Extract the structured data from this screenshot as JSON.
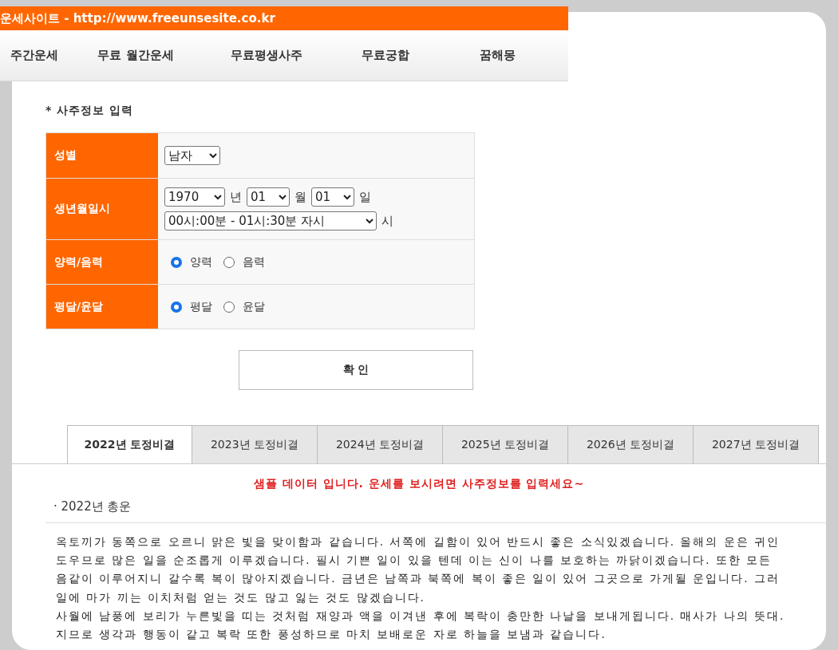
{
  "site_title": "운세사이트 - http://www.freeunsesite.co.kr",
  "nav": [
    "주간운세",
    "무료 월간운세",
    "무료평생사주",
    "무료궁합",
    "꿈해몽"
  ],
  "form": {
    "title": "* 사주정보 입력",
    "rows": [
      {
        "kind": "select",
        "label": "성별",
        "selects": [
          {
            "value": "남자"
          }
        ]
      },
      {
        "kind": "date",
        "label": "생년월일시",
        "year": "1970",
        "year_unit": "년",
        "month": "01",
        "month_unit": "월",
        "day": "01",
        "day_unit": "일",
        "time": "00시:00분 - 01시:30분 자시",
        "time_unit": "시"
      },
      {
        "kind": "radio",
        "label": "양력/음력",
        "options": [
          {
            "label": "양력",
            "selected": true
          },
          {
            "label": "음력",
            "selected": false
          }
        ]
      },
      {
        "kind": "radio",
        "label": "평달/윤달",
        "options": [
          {
            "label": "평달",
            "selected": true
          },
          {
            "label": "윤달",
            "selected": false
          }
        ]
      }
    ],
    "submit": "확 인"
  },
  "tabs": [
    {
      "label": "2022년 토정비결",
      "selected": true
    },
    {
      "label": "2023년 토정비결",
      "selected": false
    },
    {
      "label": "2024년 토정비결",
      "selected": false
    },
    {
      "label": "2025년 토정비결",
      "selected": false
    },
    {
      "label": "2026년 토정비결",
      "selected": false
    },
    {
      "label": "2027년 토정비결",
      "selected": false
    }
  ],
  "notice": "샘플 데이터 입니다. 운세를 보시려면 사주정보를 입력세요~",
  "section_title": "· 2022년 총운",
  "paragraph_lines": [
    "옥토끼가 동쪽으로 오르니 맑은 빛을 맞이함과 같습니다. 서쪽에 길함이 있어 반드시 좋은 소식있겠습니다. 올해의 운은 귀인",
    "도우므로 많은 일을 순조롭게 이루겠습니다. 필시 기쁜 일이 있을 텐데 이는 신이 나를 보호하는 까닭이겠습니다. 또한 모든",
    "음같이 이루어지니 갈수록 복이 많아지겠습니다. 금년은 남쪽과 북쪽에 복이 좋은 일이 있어 그곳으로 가게될 운입니다. 그러",
    "일에 마가 끼는 이치처럼 얻는 것도 많고 잃는 것도 많겠습니다.",
    "사월에 남풍에 보리가 누른빛을 띠는 것처럼 재양과 액을 이겨낸 후에 복락이 충만한 나날을 보내게됩니다. 매사가 나의 뜻대.",
    "지므로 생각과 행동이 같고 복락 또한 풍성하므로 마치 보배로운 자로 하늘을 보냄과 같습니다."
  ]
}
